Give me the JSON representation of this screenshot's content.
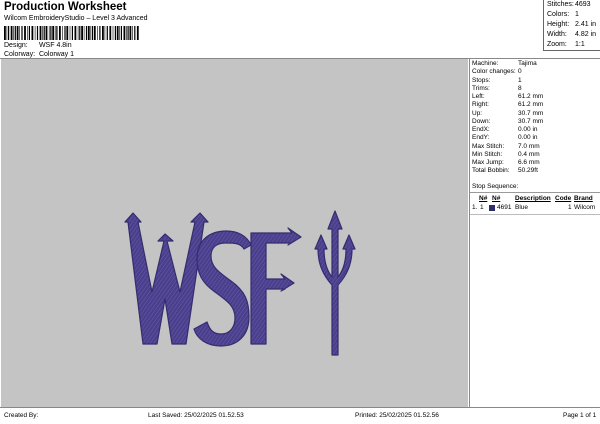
{
  "header": {
    "title": "Production Worksheet",
    "subtitle": "Wilcom EmbroideryStudio – Level 3 Advanced",
    "design_label": "Design:",
    "design_value": "WSF 4.8in",
    "colorway_label": "Colorway:",
    "colorway_value": "Colorway 1"
  },
  "stats": {
    "stitches_label": "Stitches:",
    "stitches_value": "4693",
    "colors_label": "Colors:",
    "colors_value": "1",
    "height_label": "Height:",
    "height_value": "2.41 in",
    "width_label": "Width:",
    "width_value": "4.82 in",
    "zoom_label": "Zoom:",
    "zoom_value": "1:1"
  },
  "design": {
    "text": "WSF",
    "thread_color": "#4a3f8c",
    "thread_shade": "#352c6e",
    "thread_highlight": "#6e63ad",
    "background_color": "#c4c4c4"
  },
  "machine_info": [
    {
      "label": "Machine:",
      "value": "Tajima"
    },
    {
      "label": "Color changes:",
      "value": "0"
    },
    {
      "label": "Stops:",
      "value": "1"
    },
    {
      "label": "Trims:",
      "value": "8"
    },
    {
      "label": "Left:",
      "value": "61.2 mm"
    },
    {
      "label": "Right:",
      "value": "61.2 mm"
    },
    {
      "label": "Up:",
      "value": "30.7 mm"
    },
    {
      "label": "Down:",
      "value": "30.7 mm"
    },
    {
      "label": "EndX:",
      "value": "0.00 in"
    },
    {
      "label": "EndY:",
      "value": "0.00 in"
    },
    {
      "label": "Max Stitch:",
      "value": "7.0 mm"
    },
    {
      "label": "Min Stitch:",
      "value": "0.4 mm"
    },
    {
      "label": "Max Jump:",
      "value": "6.6 mm"
    },
    {
      "label": "Total Bobbin:",
      "value": "50.29ft"
    }
  ],
  "stop_sequence": {
    "title": "Stop Sequence:",
    "columns": {
      "num": "N#",
      "n": "N#",
      "description": "Description",
      "code": "Code",
      "brand": "Brand"
    },
    "rows": [
      {
        "index": "1.",
        "num": "1",
        "swatch_color": "#2e2d6e",
        "stitches": "4691",
        "description": "Blue",
        "code": "1",
        "brand": "Wilcom"
      }
    ]
  },
  "footer": {
    "created_by": "Created By:",
    "last_saved": "Last Saved: 25/02/2025 01.52.53",
    "printed": "Printed: 25/02/2025 01.52.56",
    "page": "Page 1 of 1"
  }
}
